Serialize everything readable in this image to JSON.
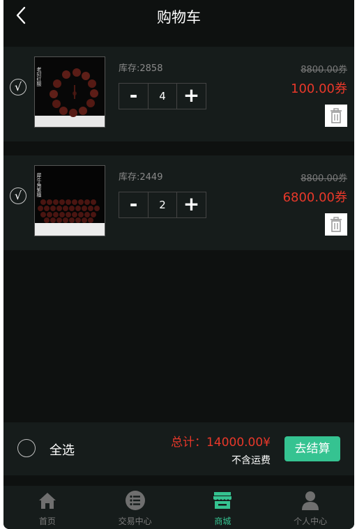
{
  "header": {
    "title": "购物车",
    "back_icon": "chevron-left-icon"
  },
  "cart": {
    "items": [
      {
        "checkmark": "√",
        "stock_label": "库存:2858",
        "quantity": "4",
        "minus": "-",
        "plus": "+",
        "original_price": "8800.00券",
        "price": "100.00券",
        "delete_icon": "trash-icon",
        "image_caption": "老挝红酸"
      },
      {
        "checkmark": "√",
        "stock_label": "库存:2449",
        "quantity": "2",
        "minus": "-",
        "plus": "+",
        "original_price": "8800.00券",
        "price": "6800.00券",
        "delete_icon": "trash-icon",
        "image_caption": "犀牛角紫檀"
      }
    ]
  },
  "footer": {
    "select_all": "全选",
    "total": "总计：14000.00¥",
    "shipping_note": "不含运费",
    "checkout": "去结算"
  },
  "tabbar": {
    "tabs": [
      {
        "label": "首页",
        "icon": "home-icon",
        "active": false
      },
      {
        "label": "交易中心",
        "icon": "list-icon",
        "active": false
      },
      {
        "label": "商城",
        "icon": "store-icon",
        "active": true
      },
      {
        "label": "个人中心",
        "icon": "user-icon",
        "active": false
      }
    ]
  },
  "colors": {
    "background": "#0e1110",
    "card": "#161c1b",
    "price_red": "#e8382a",
    "accent_green": "#35c391"
  }
}
